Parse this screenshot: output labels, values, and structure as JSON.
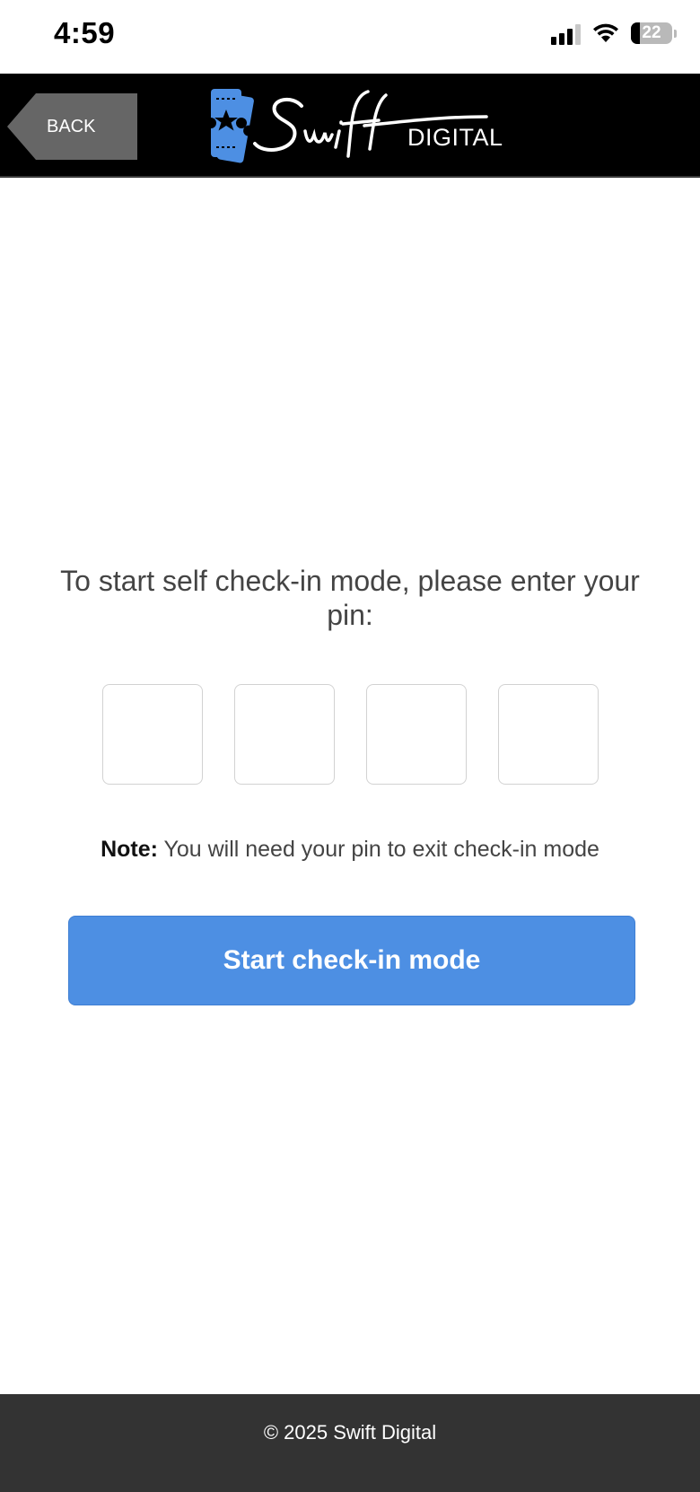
{
  "status_bar": {
    "time": "4:59",
    "battery_percent": "22",
    "battery_level": 0.22,
    "icons": [
      "cellular-signal-icon",
      "wifi-icon",
      "battery-icon"
    ]
  },
  "header": {
    "back_label": "BACK",
    "logo_text": "DIGITAL",
    "logo_icon": "ticket-star-icon",
    "background_color": "#000000",
    "back_color": "#666666",
    "logo_accent_color": "#4d8fe3"
  },
  "main": {
    "prompt": "To start self check-in mode, please enter your pin:",
    "pin_fields": [
      {
        "value": ""
      },
      {
        "value": ""
      },
      {
        "value": ""
      },
      {
        "value": ""
      }
    ],
    "note_label": "Note:",
    "note_text": " You will need your pin to exit check-in mode",
    "start_button_label": "Start check-in mode",
    "button_color": "#4d8fe3"
  },
  "footer": {
    "copyright": "© 2025 Swift Digital",
    "background_color": "#333333"
  }
}
